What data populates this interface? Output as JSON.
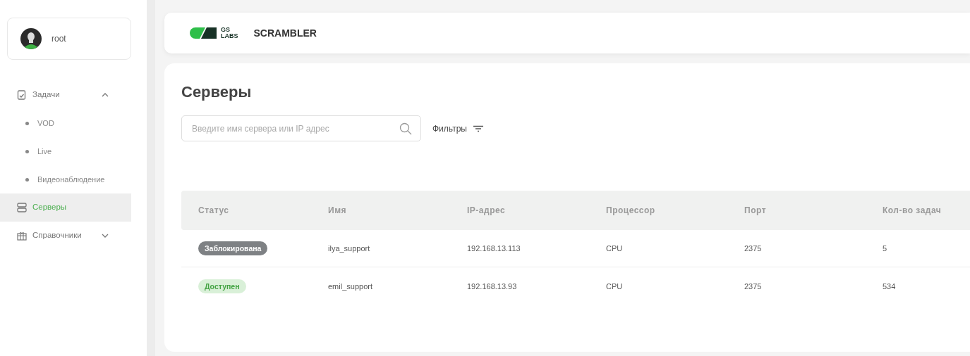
{
  "user": {
    "name": "root"
  },
  "sidebar": {
    "items": [
      {
        "label": "Задачи",
        "selected": false,
        "expanded": true,
        "children": [
          {
            "label": "VOD",
            "selected": false
          },
          {
            "label": "Live",
            "selected": false
          },
          {
            "label": "Видеонаблюдение",
            "selected": false
          }
        ]
      },
      {
        "label": "Серверы",
        "selected": true
      },
      {
        "label": "Справочники",
        "selected": false,
        "expanded": false
      }
    ]
  },
  "header": {
    "logo": [
      "GS",
      "LABS"
    ],
    "app_name": "SCRAMBLER"
  },
  "page": {
    "title": "Серверы",
    "search": {
      "placeholder": "Введите имя сервера или IP адрес"
    },
    "filters_label": "Фильтры"
  },
  "table": {
    "columns": [
      "Статус",
      "Имя",
      "IP-адрес",
      "Процессор",
      "Порт",
      "Кол-во задач"
    ],
    "rows": [
      {
        "cells": [
          {
            "label": "Заблокирована",
            "kind": "blocked"
          },
          "ilya_support",
          "192.168.13.113",
          "CPU",
          "2375",
          "5"
        ]
      },
      {
        "cells": [
          {
            "label": "Доступен",
            "kind": "available"
          },
          "emil_support",
          "192.168.13.93",
          "CPU",
          "2375",
          "534"
        ]
      }
    ]
  }
}
